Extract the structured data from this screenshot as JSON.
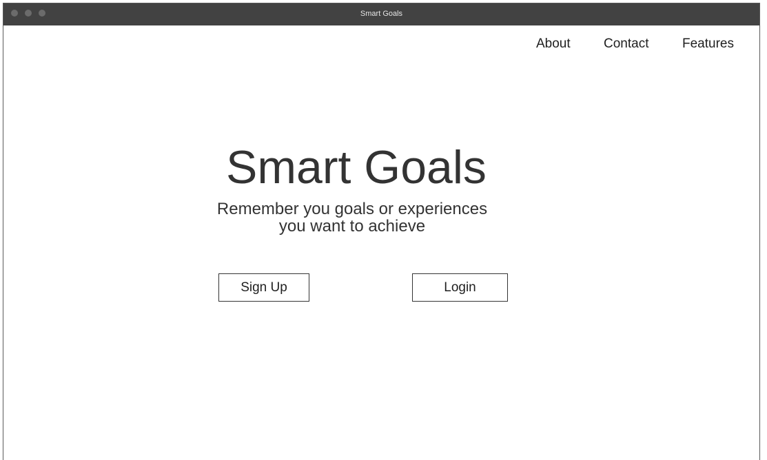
{
  "window": {
    "title": "Smart Goals"
  },
  "nav": {
    "items": [
      {
        "label": "About"
      },
      {
        "label": "Contact"
      },
      {
        "label": "Features"
      }
    ]
  },
  "hero": {
    "title": "Smart Goals",
    "subtitle": "Remember you goals or experiences you want to achieve"
  },
  "actions": {
    "signup_label": "Sign Up",
    "login_label": "Login"
  },
  "colors": {
    "titlebar": "#424242",
    "text": "#333333",
    "border": "#333333"
  }
}
